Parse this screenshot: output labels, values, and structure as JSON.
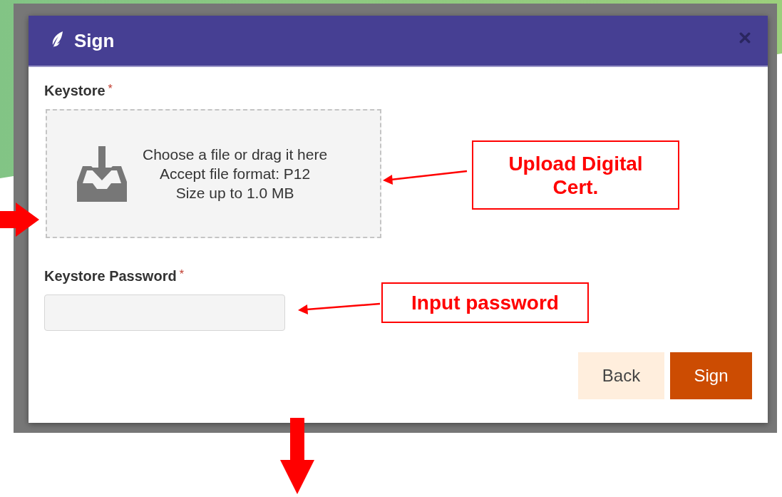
{
  "dialog": {
    "title": "Sign",
    "fields": [
      {
        "kind": "upload",
        "label": "Keystore",
        "required_mark": "*",
        "lines": [
          "Choose a file or drag it here",
          "Accept file format: P12",
          "Size up to 1.0 MB"
        ]
      },
      {
        "kind": "password",
        "label": "Keystore Password",
        "required_mark": "*"
      }
    ],
    "buttons": [
      {
        "label": "Back",
        "kind": "secondary"
      },
      {
        "label": "Sign",
        "kind": "primary"
      }
    ]
  },
  "annotations": [
    {
      "kind": "callout",
      "text": "Upload Digital Cert."
    },
    {
      "kind": "callout",
      "text": "Input password"
    }
  ]
}
